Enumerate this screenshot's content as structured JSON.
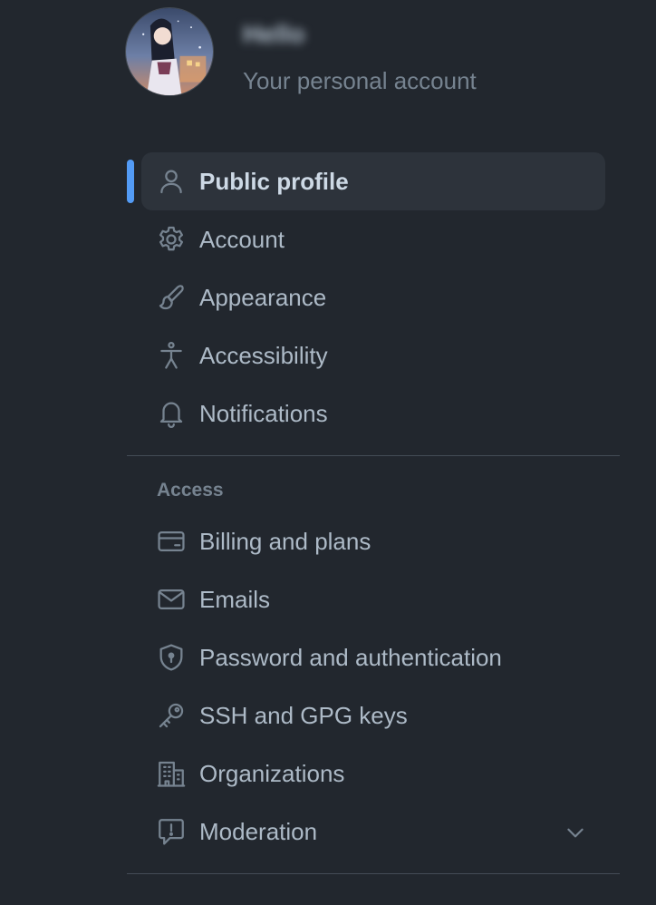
{
  "account": {
    "name": "Hello",
    "subtitle": "Your personal account"
  },
  "nav": {
    "items": [
      {
        "label": "Public profile",
        "icon": "person-icon",
        "selected": true
      },
      {
        "label": "Account",
        "icon": "gear-icon"
      },
      {
        "label": "Appearance",
        "icon": "paintbrush-icon"
      },
      {
        "label": "Accessibility",
        "icon": "accessibility-icon"
      },
      {
        "label": "Notifications",
        "icon": "bell-icon"
      }
    ],
    "access_section_title": "Access",
    "access_items": [
      {
        "label": "Billing and plans",
        "icon": "credit-card-icon"
      },
      {
        "label": "Emails",
        "icon": "mail-icon"
      },
      {
        "label": "Password and authentication",
        "icon": "shield-lock-icon"
      },
      {
        "label": "SSH and GPG keys",
        "icon": "key-icon"
      },
      {
        "label": "Organizations",
        "icon": "organization-icon"
      },
      {
        "label": "Moderation",
        "icon": "report-icon",
        "expandable": true
      }
    ]
  },
  "colors": {
    "background": "#22272e",
    "selected_bg": "#2d333b",
    "accent": "#539bf5",
    "text": "#adbac7",
    "muted": "#768390"
  }
}
